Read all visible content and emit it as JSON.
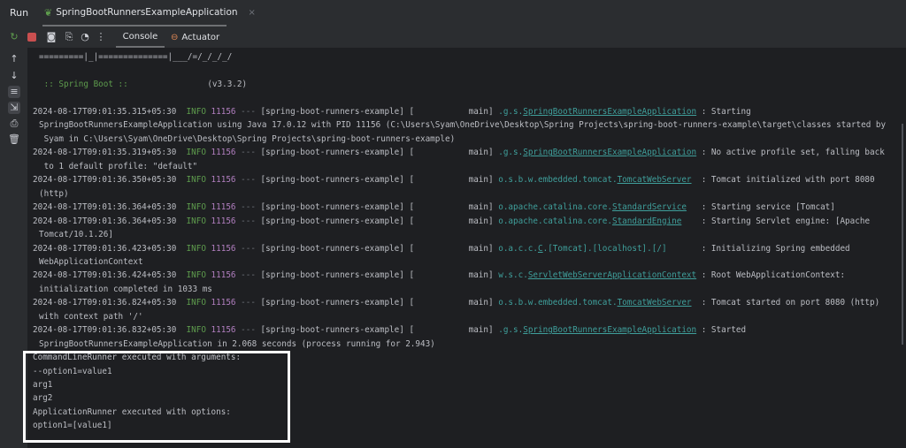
{
  "header": {
    "run_label": "Run",
    "tab_title": "SpringBootRunnersExampleApplication",
    "tab_close": "×"
  },
  "toolbar": {
    "console_tab": "Console",
    "actuator_tab": "Actuator"
  },
  "icons": [
    "rerun-icon",
    "stop-icon",
    "camera-icon",
    "dump-icon",
    "profiler-icon",
    "more-icon"
  ],
  "side_icons": [
    "arrow-up-icon",
    "arrow-down-icon",
    "soft-wrap-icon",
    "scroll-to-end-icon",
    "print-icon",
    "trash-icon"
  ],
  "colors": {
    "background": "#1e1f22",
    "info": "#5e9c4d",
    "pid": "#b27fc0",
    "logger": "#3f9f9b",
    "highlight": "#ffffff"
  },
  "console": {
    "banner": "=========|_|==============|___/=/_/_/_/",
    "spring_boot_label": " :: Spring Boot :: ",
    "spring_boot_version": "               (v3.3.2)",
    "logs": [
      {
        "ts": "2024-08-17T09:01:35.315+05:30",
        "level": "INFO",
        "pid": "11156",
        "thread": "[spring-boot-runners-example] [           main]",
        "prefix": ".g.s.",
        "cls": "SpringBootRunnersExampleApplication",
        "msg": "Starting",
        "cont": [
          "SpringBootRunnersExampleApplication using Java 17.0.12 with PID 11156 (C:\\Users\\Syam\\OneDrive\\Desktop\\Spring Projects\\spring-boot-runners-example\\target\\classes started by",
          " Syam in C:\\Users\\Syam\\OneDrive\\Desktop\\Spring Projects\\spring-boot-runners-example)"
        ]
      },
      {
        "ts": "2024-08-17T09:01:35.319+05:30",
        "level": "INFO",
        "pid": "11156",
        "thread": "[spring-boot-runners-example] [           main]",
        "prefix": ".g.s.",
        "cls": "SpringBootRunnersExampleApplication",
        "msg": "No active profile set, falling back",
        "cont": [
          " to 1 default profile: \"default\""
        ]
      },
      {
        "ts": "2024-08-17T09:01:36.350+05:30",
        "level": "INFO",
        "pid": "11156",
        "thread": "[spring-boot-runners-example] [           main]",
        "prefix": "o.s.b.w.embedded.tomcat.",
        "cls": "TomcatWebServer",
        "msg": "Tomcat initialized with port 8080",
        "cont": [
          "(http)"
        ]
      },
      {
        "ts": "2024-08-17T09:01:36.364+05:30",
        "level": "INFO",
        "pid": "11156",
        "thread": "[spring-boot-runners-example] [           main]",
        "prefix": "o.apache.catalina.core.",
        "cls": "StandardService",
        "msg": "Starting service [Tomcat]",
        "cont": []
      },
      {
        "ts": "2024-08-17T09:01:36.364+05:30",
        "level": "INFO",
        "pid": "11156",
        "thread": "[spring-boot-runners-example] [           main]",
        "prefix": "o.apache.catalina.core.",
        "cls": "StandardEngine",
        "msg": "Starting Servlet engine: [Apache",
        "cont": [
          "Tomcat/10.1.26]"
        ]
      },
      {
        "ts": "2024-08-17T09:01:36.423+05:30",
        "level": "INFO",
        "pid": "11156",
        "thread": "[spring-boot-runners-example] [           main]",
        "prefix": "o.a.c.c.",
        "cls": "C",
        "suffix": ".[Tomcat].[localhost].[/]",
        "msg": "Initializing Spring embedded",
        "cont": [
          "WebApplicationContext"
        ]
      },
      {
        "ts": "2024-08-17T09:01:36.424+05:30",
        "level": "INFO",
        "pid": "11156",
        "thread": "[spring-boot-runners-example] [           main]",
        "prefix": "w.s.c.",
        "cls": "ServletWebServerApplicationContext",
        "msg": "Root WebApplicationContext:",
        "cont": [
          "initialization completed in 1033 ms"
        ]
      },
      {
        "ts": "2024-08-17T09:01:36.824+05:30",
        "level": "INFO",
        "pid": "11156",
        "thread": "[spring-boot-runners-example] [           main]",
        "prefix": "o.s.b.w.embedded.tomcat.",
        "cls": "TomcatWebServer",
        "msg": "Tomcat started on port 8080 (http)",
        "cont": [
          "with context path '/'"
        ]
      },
      {
        "ts": "2024-08-17T09:01:36.832+05:30",
        "level": "INFO",
        "pid": "11156",
        "thread": "[spring-boot-runners-example] [           main]",
        "prefix": ".g.s.",
        "cls": "SpringBootRunnersExampleApplication",
        "msg": "Started",
        "cont": [
          "SpringBootRunnersExampleApplication in 2.068 seconds (process running for 2.943)"
        ]
      }
    ],
    "output": [
      "CommandLineRunner executed with arguments:",
      "--option1=value1",
      "arg1",
      "arg2",
      "ApplicationRunner executed with options:",
      "option1=[value1]"
    ]
  }
}
